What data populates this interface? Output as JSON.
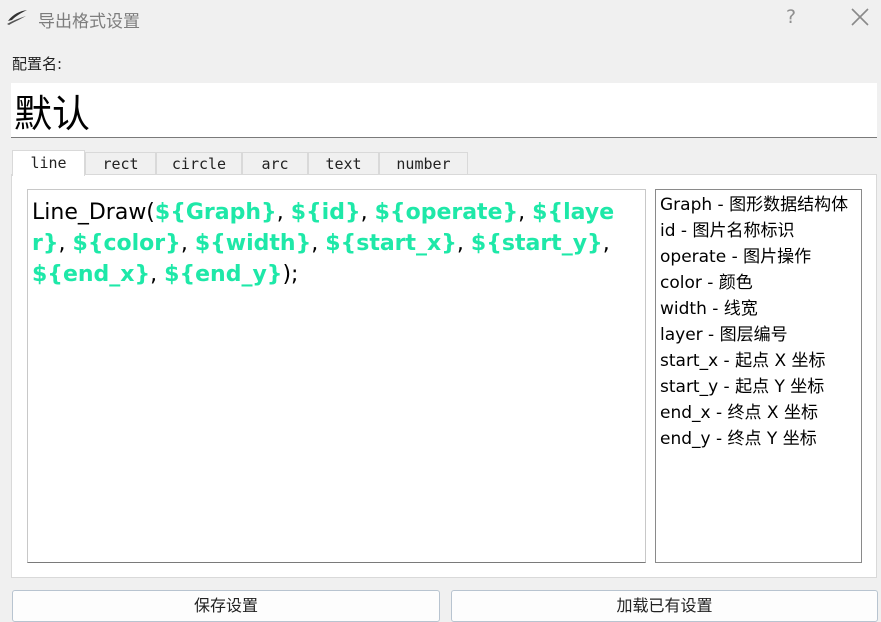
{
  "window": {
    "title": "导出格式设置",
    "help_symbol": "?"
  },
  "config": {
    "label": "配置名:",
    "value": "默认"
  },
  "tabs": [
    {
      "label": "line",
      "active": true
    },
    {
      "label": "rect",
      "active": false
    },
    {
      "label": "circle",
      "active": false
    },
    {
      "label": "arc",
      "active": false
    },
    {
      "label": "text",
      "active": false
    },
    {
      "label": "number",
      "active": false
    }
  ],
  "editor": {
    "variable_color": "#1ee8a8",
    "tokens": [
      {
        "text": "Line_Draw(",
        "var": false
      },
      {
        "text": "${Graph}",
        "var": true
      },
      {
        "text": ", ",
        "var": false
      },
      {
        "text": "${id}",
        "var": true
      },
      {
        "text": ", ",
        "var": false
      },
      {
        "text": "${operate}",
        "var": true
      },
      {
        "text": ", ",
        "var": false
      },
      {
        "text": "${layer}",
        "var": true
      },
      {
        "text": ", ",
        "var": false
      },
      {
        "text": "${color}",
        "var": true
      },
      {
        "text": ", ",
        "var": false
      },
      {
        "text": "${width}",
        "var": true
      },
      {
        "text": ", ",
        "var": false
      },
      {
        "text": "${start_x}",
        "var": true
      },
      {
        "text": ", ",
        "var": false
      },
      {
        "text": "${start_y}",
        "var": true
      },
      {
        "text": ", ",
        "var": false
      },
      {
        "text": "${end_x}",
        "var": true
      },
      {
        "text": ", ",
        "var": false
      },
      {
        "text": "${end_y}",
        "var": true
      },
      {
        "text": ");",
        "var": false
      }
    ]
  },
  "variable_help": [
    "Graph - 图形数据结构体",
    "id - 图片名称标识",
    "operate - 图片操作",
    "color - 颜色",
    "width - 线宽",
    "layer - 图层编号",
    "start_x - 起点 X 坐标",
    "start_y - 起点 Y 坐标",
    "end_x - 终点 X 坐标",
    "end_y - 终点 Y 坐标"
  ],
  "buttons": {
    "save": "保存设置",
    "load": "加载已有设置"
  }
}
